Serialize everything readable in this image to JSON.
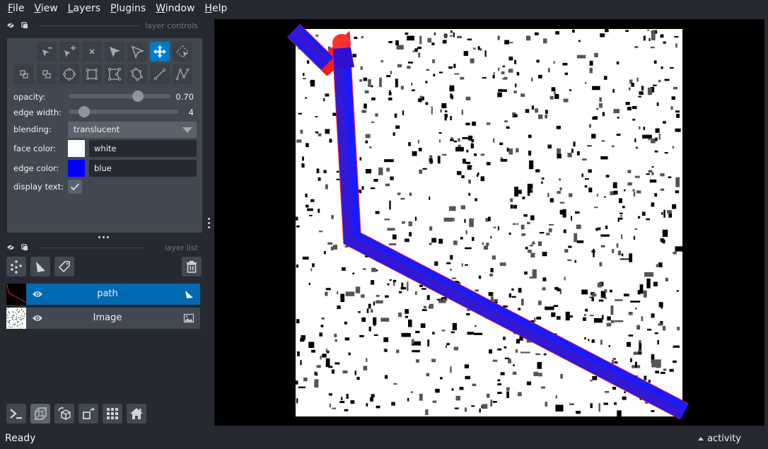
{
  "menubar": {
    "items": [
      {
        "label": "File",
        "mnemonic": "F",
        "rest": "ile"
      },
      {
        "label": "View",
        "mnemonic": "V",
        "rest": "iew"
      },
      {
        "label": "Layers",
        "mnemonic": "L",
        "rest": "ayers"
      },
      {
        "label": "Plugins",
        "mnemonic": "P",
        "rest": "lugins"
      },
      {
        "label": "Window",
        "mnemonic": "W",
        "rest": "indow"
      },
      {
        "label": "Help",
        "mnemonic": "H",
        "rest": "elp"
      }
    ]
  },
  "layer_controls": {
    "title": "layer controls",
    "tools_row1": [
      "remove-vertex",
      "add-vertex",
      "delete-shape",
      "select-shapes",
      "select-vertices",
      "pan-zoom",
      "transform"
    ],
    "tools_row2": [
      "move-back",
      "move-front",
      "add-ellipse",
      "add-rectangle",
      "add-polygon",
      "add-polygon-lasso",
      "add-line",
      "add-path"
    ],
    "active_tool": "pan-zoom",
    "opacity": {
      "label": "opacity:",
      "value": 0.7,
      "display": "0.70",
      "min": 0,
      "max": 1
    },
    "edge_width": {
      "label": "edge width:",
      "value": 4,
      "display": "4",
      "min": 0,
      "max": 40
    },
    "blending": {
      "label": "blending:",
      "value": "translucent"
    },
    "face_color": {
      "label": "face color:",
      "value": "white",
      "hex": "#ffffff"
    },
    "edge_color": {
      "label": "edge color:",
      "value": "blue",
      "hex": "#0000ff"
    },
    "display_text": {
      "label": "display text:",
      "checked": true
    }
  },
  "layer_list": {
    "title": "layer list",
    "buttons": [
      "new-points-layer",
      "new-shapes-layer",
      "new-labels-layer",
      "delete-layer"
    ],
    "layers": [
      {
        "name": "path",
        "type": "shapes",
        "visible": true,
        "selected": true
      },
      {
        "name": "Image",
        "type": "image",
        "visible": true,
        "selected": false
      }
    ]
  },
  "viewer_buttons": [
    "console",
    "ndisplay-3d",
    "roll-dims",
    "transpose-dims",
    "grid-view",
    "reset-view"
  ],
  "status": {
    "text": "Ready",
    "activity_label": "activity"
  },
  "colors": {
    "accent": "#007acc",
    "selected_layer": "#0069b4",
    "path_edge": "#0000ff",
    "highlight": "#ff0000"
  }
}
